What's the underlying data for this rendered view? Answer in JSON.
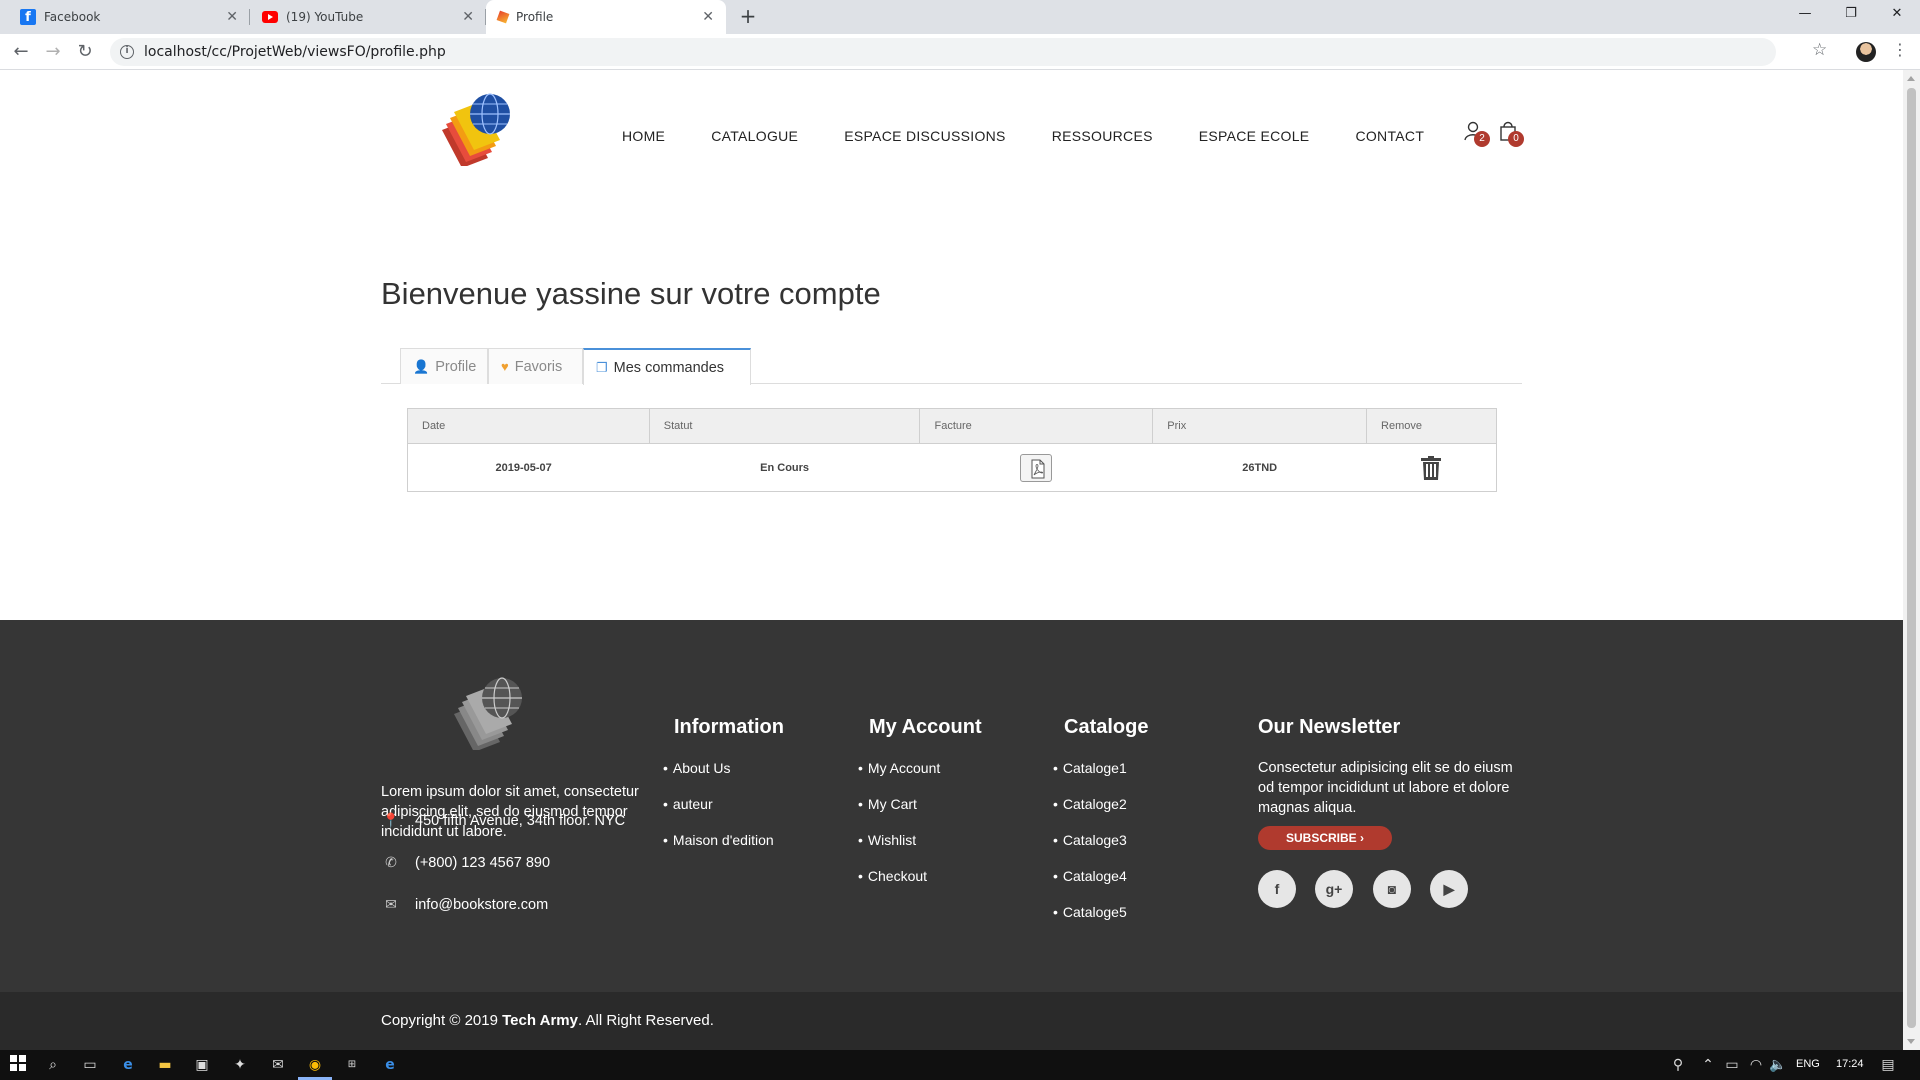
{
  "browser": {
    "tabs": [
      {
        "title": "Facebook",
        "icon": "facebook-icon"
      },
      {
        "title": "(19) YouTube",
        "icon": "youtube-icon"
      },
      {
        "title": "Profile",
        "icon": "bookstore-favicon"
      }
    ],
    "url": "localhost/cc/ProjetWeb/viewsFO/profile.php"
  },
  "nav": {
    "items": [
      "HOME",
      "CATALOGUE",
      "ESPACE DISCUSSIONS",
      "RESSOURCES",
      "ESPACE ECOLE",
      "CONTACT"
    ],
    "user_badge": "2",
    "cart_badge": "0"
  },
  "page": {
    "title": "Bienvenue yassine sur votre compte",
    "tabs": [
      "Profile",
      "Favoris",
      "Mes commandes"
    ],
    "active_tab": "Mes commandes"
  },
  "orders": {
    "headers": [
      "Date",
      "Statut",
      "Facture",
      "Prix",
      "Remove"
    ],
    "rows": [
      {
        "date": "2019-05-07",
        "statut": "En Cours",
        "prix": "26TND"
      }
    ]
  },
  "footer": {
    "about": "Lorem ipsum dolor sit amet, consectetur adipiscing elit, sed do eiusmod tempor incididunt ut labore.",
    "address": "450 fifth Avenue, 34th floor. NYC",
    "phone": "(+800) 123 4567 890",
    "email": "info@bookstore.com",
    "information": {
      "title": "Information",
      "items": [
        "About Us",
        "auteur",
        "Maison d'edition"
      ]
    },
    "account": {
      "title": "My Account",
      "items": [
        "My Account",
        "My Cart",
        "Wishlist",
        "Checkout"
      ]
    },
    "catalog": {
      "title": "Cataloge",
      "items": [
        "Cataloge1",
        "Cataloge2",
        "Cataloge3",
        "Cataloge4",
        "Cataloge5"
      ]
    },
    "newsletter": {
      "title": "Our Newsletter",
      "text": "Consectetur adipisicing elit se do eiusm od tempor incididunt ut labore et dolore magnas aliqua.",
      "button": "SUBSCRIBE"
    },
    "copyright_prefix": "Copyright © 2019 ",
    "copyright_brand": "Tech Army",
    "copyright_suffix": ". All Right Reserved."
  },
  "taskbar": {
    "lang": "ENG",
    "time": "17:24"
  },
  "colors": {
    "accent": "#b03a2e",
    "footer_bg": "#363636",
    "tab_active_border": "#4a90d9"
  }
}
